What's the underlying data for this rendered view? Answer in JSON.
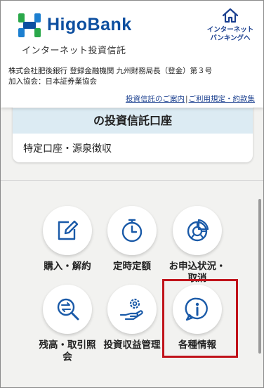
{
  "colors": {
    "brand_blue": "#0d4fa0",
    "brand_green": "#2aa84a",
    "icon_blue": "#1a5aa8",
    "highlight": "#c0131a",
    "card_head_bg": "#dcebf3"
  },
  "header": {
    "logo_text": "HigoBank",
    "subtitle": "インターネット投資信託",
    "ib_link_line1": "インターネット",
    "ib_link_line2": "バンキングへ",
    "corp_line1": "株式会社肥後銀行 登録金融機関 九州財務局長（登金）第３号",
    "corp_line2": "加入協会：日本証券業協会",
    "link_guide": "投資信託のご案内",
    "link_sep": "|",
    "link_terms": "ご利用規定・約款集"
  },
  "account_card": {
    "title": "の投資信託口座",
    "detail": "特定口座・源泉徴収"
  },
  "menu": [
    {
      "label": "購入・解約",
      "icon": "pencil-square-icon"
    },
    {
      "label": "定時定額",
      "icon": "stopwatch-icon"
    },
    {
      "label": "お申込状況・取消",
      "icon": "pie-chart-icon"
    },
    {
      "label": "残高・取引照会",
      "icon": "exchange-magnifier-icon"
    },
    {
      "label": "投資収益管理",
      "icon": "hand-coin-gear-icon"
    },
    {
      "label": "各種情報",
      "icon": "info-icon"
    }
  ]
}
